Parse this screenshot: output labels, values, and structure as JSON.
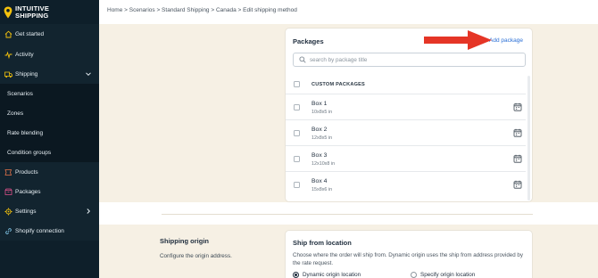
{
  "brand": {
    "line1": "INTUITIVE",
    "line2": "SHIPPING",
    "accent": "#f4c20d"
  },
  "sidebar": {
    "items": [
      {
        "label": "Get started",
        "icon": "home-icon"
      },
      {
        "label": "Activity",
        "icon": "activity-icon"
      },
      {
        "label": "Shipping",
        "icon": "truck-icon",
        "expanded": true
      },
      {
        "label": "Scenarios"
      },
      {
        "label": "Zones"
      },
      {
        "label": "Rate blending"
      },
      {
        "label": "Condition groups"
      },
      {
        "label": "Products",
        "icon": "tag-icon"
      },
      {
        "label": "Packages",
        "icon": "box-icon"
      },
      {
        "label": "Settings",
        "icon": "gear-icon"
      },
      {
        "label": "Shopify connection",
        "icon": "link-icon"
      }
    ]
  },
  "breadcrumb": "Home > Scenarios > Standard Shipping > Canada > Edit shipping method",
  "packages": {
    "title": "Packages",
    "add_label": "Add package",
    "search_placeholder": "search by package title",
    "column_header": "CUSTOM PACKAGES",
    "rows": [
      {
        "name": "Box 1",
        "dims": "10x8x5 in"
      },
      {
        "name": "Box 2",
        "dims": "12x8x5 in"
      },
      {
        "name": "Box 3",
        "dims": "12x10x8 in"
      },
      {
        "name": "Box 4",
        "dims": "15x8x6 in"
      }
    ]
  },
  "origin": {
    "title": "Shipping origin",
    "description": "Configure the origin address."
  },
  "ship_from": {
    "title": "Ship from location",
    "description": "Choose where the order will ship from. Dynamic origin uses the ship from address provided by the rate request.",
    "options": [
      {
        "label": "Dynamic origin location",
        "selected": true
      },
      {
        "label": "Specify origin location",
        "selected": false
      }
    ]
  },
  "colors": {
    "sidebar_bg": "#0e1f2a",
    "link": "#2a6fd6",
    "arrow": "#e53526",
    "beige": "#f6f0e4"
  }
}
